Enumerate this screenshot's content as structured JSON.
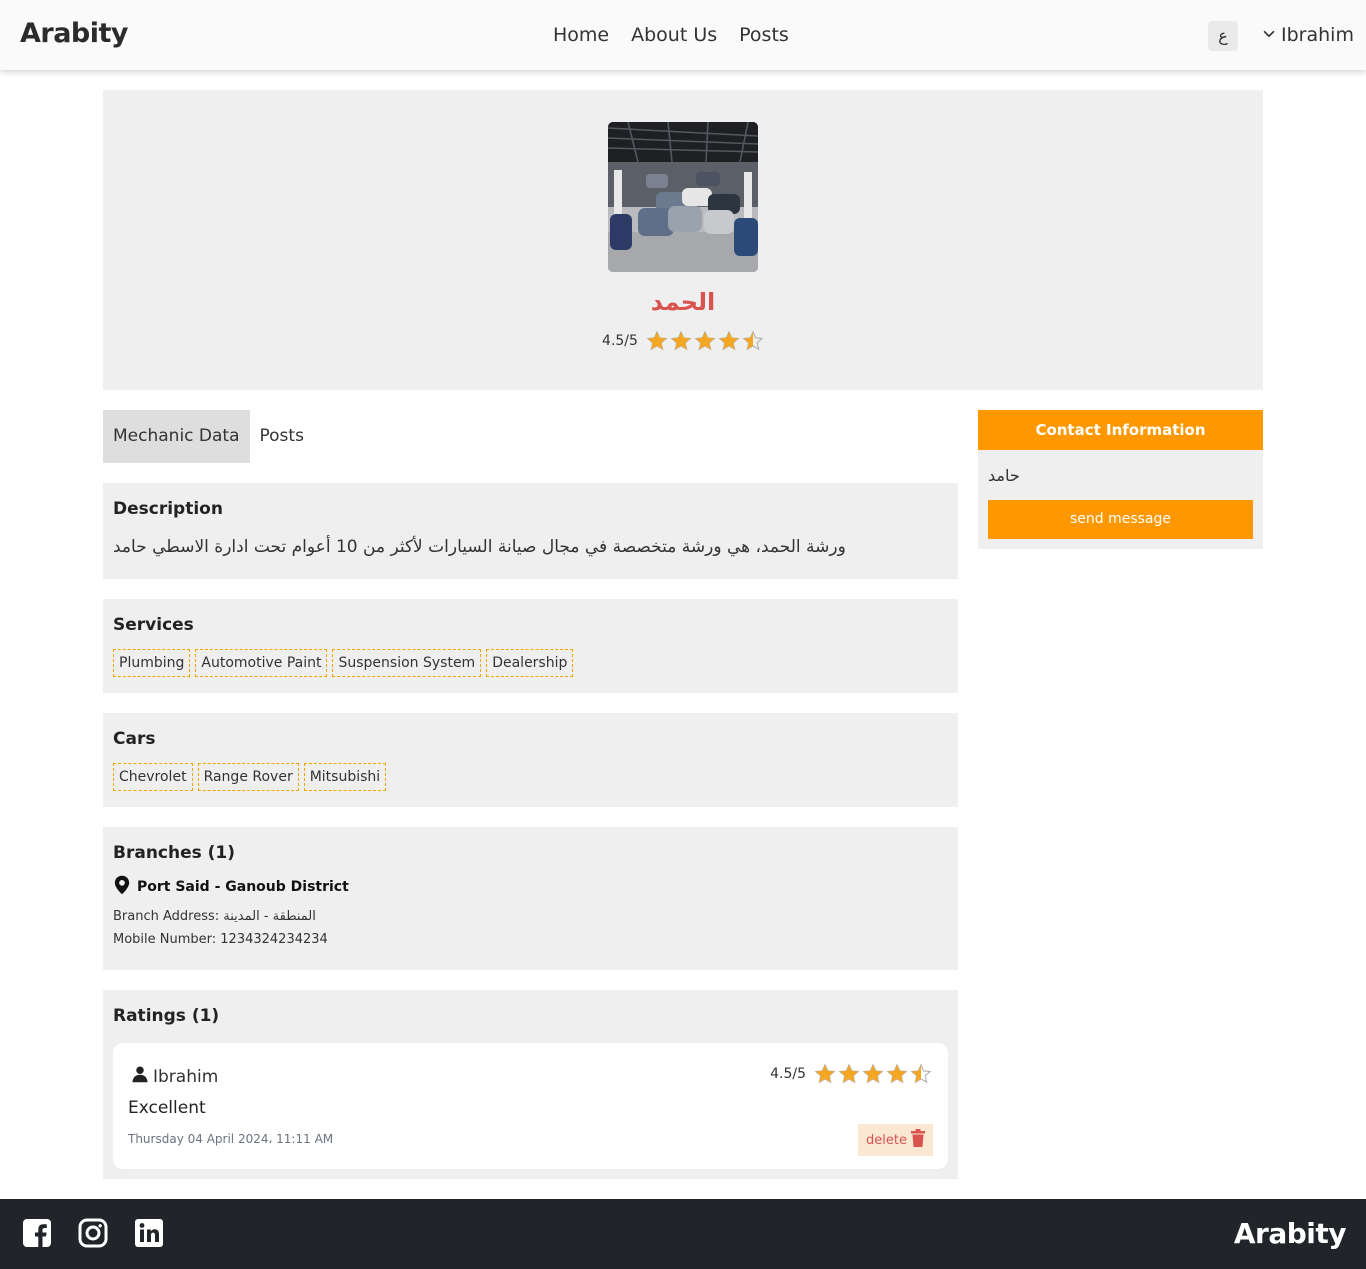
{
  "header": {
    "brand": "Arabity",
    "nav": [
      "Home",
      "About Us",
      "Posts"
    ],
    "lang_toggle": "ع",
    "user_name": "Ibrahim"
  },
  "profile": {
    "name": "الحمد",
    "rating_text": "4.5/5",
    "rating": 4.5,
    "rating_max": 5
  },
  "tabs": [
    "Mechanic Data",
    "Posts"
  ],
  "description": {
    "title": "Description",
    "text": "ورشة الحمد، هي ورشة متخصصة في مجال صيانة السيارات لأكثر من 10 أعوام تحت ادارة الاسطي حامد"
  },
  "services": {
    "title": "Services",
    "items": [
      "Plumbing",
      "Automotive Paint",
      "Suspension System",
      "Dealership"
    ]
  },
  "cars": {
    "title": "Cars",
    "items": [
      "Chevrolet",
      "Range Rover",
      "Mitsubishi"
    ]
  },
  "branches": {
    "title": "Branches (1)",
    "items": [
      {
        "name": "Port Said - Ganoub District",
        "address": "Branch Address: المنطقة - المدينة",
        "mobile": "Mobile Number: 1234324234234"
      }
    ]
  },
  "ratings": {
    "title": "Ratings (1)",
    "items": [
      {
        "user": "Ibrahim",
        "rating_text": "4.5/5",
        "rating": 4.5,
        "comment": "Excellent",
        "date": "Thursday 04 April 2024، 11:11 AM",
        "delete_label": "delete"
      }
    ]
  },
  "contact": {
    "title": "Contact Information",
    "name": "حامد",
    "send_label": "send message"
  },
  "footer": {
    "brand": "Arabity",
    "social": [
      "facebook-icon",
      "instagram-icon",
      "linkedin-icon"
    ]
  },
  "colors": {
    "accent": "#ff9800",
    "star": "#f5a623",
    "name": "#d9534f",
    "footer_bg": "#212529",
    "panel_bg": "#efefef"
  }
}
